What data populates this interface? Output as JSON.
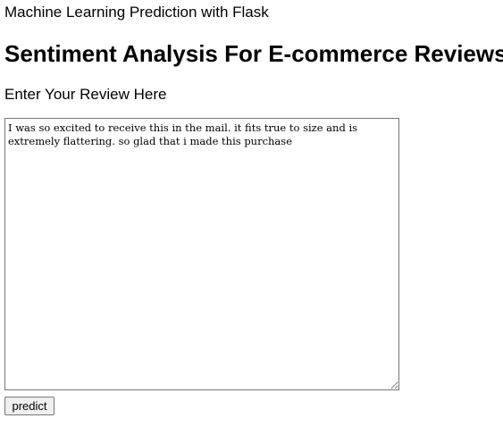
{
  "header": {
    "subtitle": "Machine Learning Prediction with Flask",
    "title": "Sentiment Analysis For E-commerce Reviews"
  },
  "form": {
    "label": "Enter Your Review Here",
    "review_text": "I was so excited to receive this in the mail. it fits true to size and is extremely flattering. so glad that i made this purchase",
    "submit_label": "predict"
  }
}
